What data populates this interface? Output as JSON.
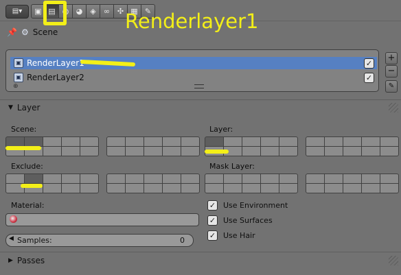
{
  "header": {
    "editor_menu_icon": "properties-editor-icon",
    "context_tabs": [
      {
        "icon": "render-icon",
        "glyph": "▣"
      },
      {
        "icon": "render-layers-icon",
        "glyph": "▤"
      },
      {
        "icon": "scene-icon",
        "glyph": "◍"
      },
      {
        "icon": "world-icon",
        "glyph": "◕"
      },
      {
        "icon": "object-icon",
        "glyph": "◈"
      },
      {
        "icon": "constraints-icon",
        "glyph": "∞"
      },
      {
        "icon": "modifiers-icon",
        "glyph": "✣"
      },
      {
        "icon": "texture-icon",
        "glyph": "▦"
      },
      {
        "icon": "particles-icon",
        "glyph": "✎"
      }
    ]
  },
  "annotation": {
    "text": "Renderlayer1",
    "color": "#f3ef18"
  },
  "breadcrumb": {
    "pin_icon": "pin-icon",
    "scene_icon": "scene-icon",
    "label": "Scene"
  },
  "render_layers": {
    "items": [
      {
        "label": "RenderLayer1",
        "selected": true,
        "checked": true
      },
      {
        "label": "RenderLayer2",
        "selected": false,
        "checked": true
      }
    ]
  },
  "side_buttons": {
    "add": "+",
    "remove": "−",
    "pin": "pin-icon"
  },
  "layer_panel": {
    "title": "Layer",
    "scene_label": "Scene:",
    "layer_label": "Layer:",
    "exclude_label": "Exclude:",
    "mask_layer_label": "Mask Layer:",
    "scene_layers_on": [
      0,
      1
    ],
    "layer_layers_on": [
      0
    ],
    "exclude_layers_on": [
      1
    ],
    "mask_layers_on": [],
    "material_label": "Material:",
    "samples_label": "Samples:",
    "samples_value": "0",
    "use_environment": "Use Environment",
    "use_surfaces": "Use Surfaces",
    "use_hair": "Use Hair"
  },
  "passes_panel": {
    "title": "Passes"
  },
  "colors": {
    "selection": "#5680c2",
    "highlight": "#f3ef18"
  }
}
